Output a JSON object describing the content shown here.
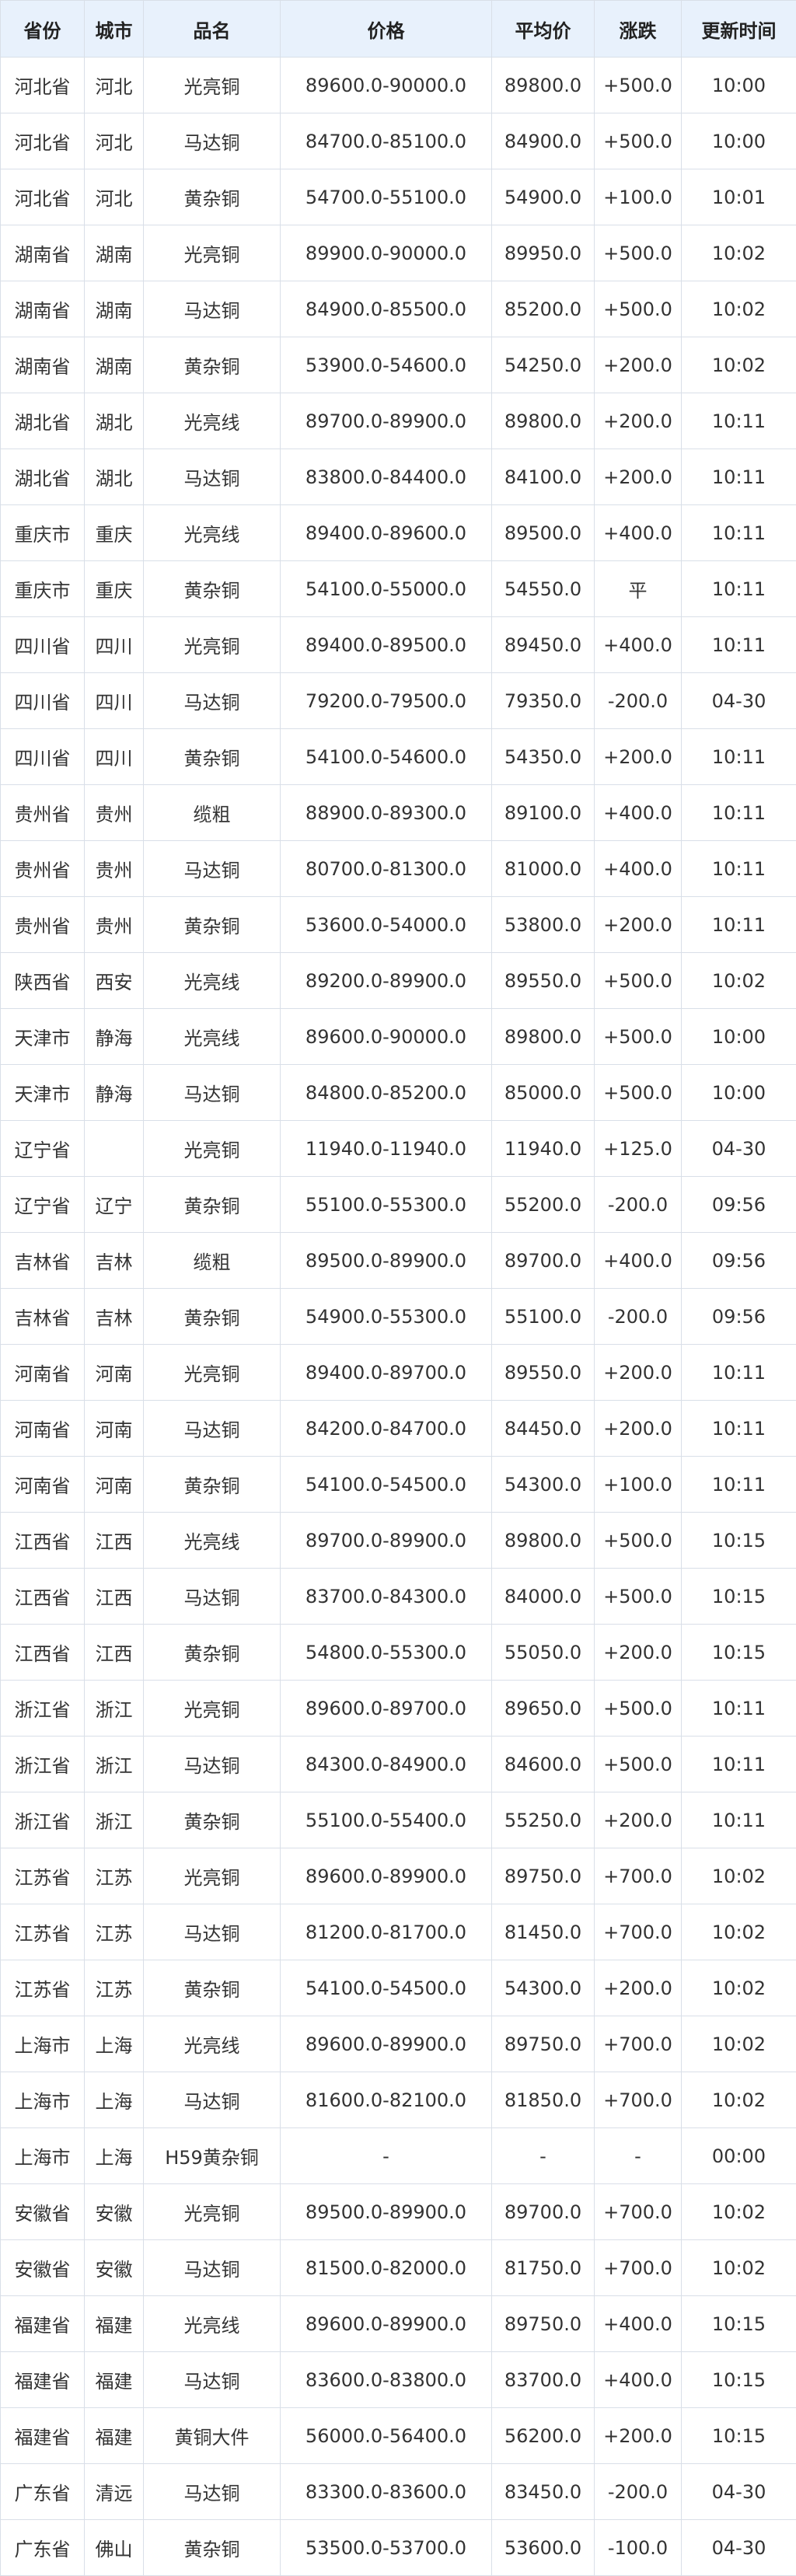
{
  "table": {
    "columns": [
      "省份",
      "城市",
      "品名",
      "价格",
      "平均价",
      "涨跌",
      "更新时间"
    ],
    "rows": [
      {
        "province": "河北省",
        "city": "河北",
        "product": "光亮铜",
        "price": "89600.0-90000.0",
        "avg": "89800.0",
        "change": "+500.0",
        "trend": "up",
        "time": "10:00"
      },
      {
        "province": "河北省",
        "city": "河北",
        "product": "马达铜",
        "price": "84700.0-85100.0",
        "avg": "84900.0",
        "change": "+500.0",
        "trend": "up",
        "time": "10:00"
      },
      {
        "province": "河北省",
        "city": "河北",
        "product": "黄杂铜",
        "price": "54700.0-55100.0",
        "avg": "54900.0",
        "change": "+100.0",
        "trend": "up",
        "time": "10:01"
      },
      {
        "province": "湖南省",
        "city": "湖南",
        "product": "光亮铜",
        "price": "89900.0-90000.0",
        "avg": "89950.0",
        "change": "+500.0",
        "trend": "up",
        "time": "10:02"
      },
      {
        "province": "湖南省",
        "city": "湖南",
        "product": "马达铜",
        "price": "84900.0-85500.0",
        "avg": "85200.0",
        "change": "+500.0",
        "trend": "up",
        "time": "10:02"
      },
      {
        "province": "湖南省",
        "city": "湖南",
        "product": "黄杂铜",
        "price": "53900.0-54600.0",
        "avg": "54250.0",
        "change": "+200.0",
        "trend": "up",
        "time": "10:02"
      },
      {
        "province": "湖北省",
        "city": "湖北",
        "product": "光亮线",
        "price": "89700.0-89900.0",
        "avg": "89800.0",
        "change": "+200.0",
        "trend": "up",
        "time": "10:11"
      },
      {
        "province": "湖北省",
        "city": "湖北",
        "product": "马达铜",
        "price": "83800.0-84400.0",
        "avg": "84100.0",
        "change": "+200.0",
        "trend": "up",
        "time": "10:11"
      },
      {
        "province": "重庆市",
        "city": "重庆",
        "product": "光亮线",
        "price": "89400.0-89600.0",
        "avg": "89500.0",
        "change": "+400.0",
        "trend": "up",
        "time": "10:11"
      },
      {
        "province": "重庆市",
        "city": "重庆",
        "product": "黄杂铜",
        "price": "54100.0-55000.0",
        "avg": "54550.0",
        "change": "平",
        "trend": "flat",
        "time": "10:11"
      },
      {
        "province": "四川省",
        "city": "四川",
        "product": "光亮铜",
        "price": "89400.0-89500.0",
        "avg": "89450.0",
        "change": "+400.0",
        "trend": "up",
        "time": "10:11"
      },
      {
        "province": "四川省",
        "city": "四川",
        "product": "马达铜",
        "price": "79200.0-79500.0",
        "avg": "79350.0",
        "change": "-200.0",
        "trend": "down",
        "time": "04-30"
      },
      {
        "province": "四川省",
        "city": "四川",
        "product": "黄杂铜",
        "price": "54100.0-54600.0",
        "avg": "54350.0",
        "change": "+200.0",
        "trend": "up",
        "time": "10:11"
      },
      {
        "province": "贵州省",
        "city": "贵州",
        "product": "缆粗",
        "price": "88900.0-89300.0",
        "avg": "89100.0",
        "change": "+400.0",
        "trend": "up",
        "time": "10:11"
      },
      {
        "province": "贵州省",
        "city": "贵州",
        "product": "马达铜",
        "price": "80700.0-81300.0",
        "avg": "81000.0",
        "change": "+400.0",
        "trend": "up",
        "time": "10:11"
      },
      {
        "province": "贵州省",
        "city": "贵州",
        "product": "黄杂铜",
        "price": "53600.0-54000.0",
        "avg": "53800.0",
        "change": "+200.0",
        "trend": "up",
        "time": "10:11"
      },
      {
        "province": "陕西省",
        "city": "西安",
        "product": "光亮线",
        "price": "89200.0-89900.0",
        "avg": "89550.0",
        "change": "+500.0",
        "trend": "up",
        "time": "10:02"
      },
      {
        "province": "天津市",
        "city": "静海",
        "product": "光亮线",
        "price": "89600.0-90000.0",
        "avg": "89800.0",
        "change": "+500.0",
        "trend": "up",
        "time": "10:00"
      },
      {
        "province": "天津市",
        "city": "静海",
        "product": "马达铜",
        "price": "84800.0-85200.0",
        "avg": "85000.0",
        "change": "+500.0",
        "trend": "up",
        "time": "10:00"
      },
      {
        "province": "辽宁省",
        "city": "",
        "product": "光亮铜",
        "price": "11940.0-11940.0",
        "avg": "11940.0",
        "change": "+125.0",
        "trend": "up",
        "time": "04-30"
      },
      {
        "province": "辽宁省",
        "city": "辽宁",
        "product": "黄杂铜",
        "price": "55100.0-55300.0",
        "avg": "55200.0",
        "change": "-200.0",
        "trend": "down",
        "time": "09:56"
      },
      {
        "province": "吉林省",
        "city": "吉林",
        "product": "缆粗",
        "price": "89500.0-89900.0",
        "avg": "89700.0",
        "change": "+400.0",
        "trend": "up",
        "time": "09:56"
      },
      {
        "province": "吉林省",
        "city": "吉林",
        "product": "黄杂铜",
        "price": "54900.0-55300.0",
        "avg": "55100.0",
        "change": "-200.0",
        "trend": "down",
        "time": "09:56"
      },
      {
        "province": "河南省",
        "city": "河南",
        "product": "光亮铜",
        "price": "89400.0-89700.0",
        "avg": "89550.0",
        "change": "+200.0",
        "trend": "up",
        "time": "10:11"
      },
      {
        "province": "河南省",
        "city": "河南",
        "product": "马达铜",
        "price": "84200.0-84700.0",
        "avg": "84450.0",
        "change": "+200.0",
        "trend": "up",
        "time": "10:11"
      },
      {
        "province": "河南省",
        "city": "河南",
        "product": "黄杂铜",
        "price": "54100.0-54500.0",
        "avg": "54300.0",
        "change": "+100.0",
        "trend": "up",
        "time": "10:11"
      },
      {
        "province": "江西省",
        "city": "江西",
        "product": "光亮线",
        "price": "89700.0-89900.0",
        "avg": "89800.0",
        "change": "+500.0",
        "trend": "up",
        "time": "10:15"
      },
      {
        "province": "江西省",
        "city": "江西",
        "product": "马达铜",
        "price": "83700.0-84300.0",
        "avg": "84000.0",
        "change": "+500.0",
        "trend": "up",
        "time": "10:15"
      },
      {
        "province": "江西省",
        "city": "江西",
        "product": "黄杂铜",
        "price": "54800.0-55300.0",
        "avg": "55050.0",
        "change": "+200.0",
        "trend": "up",
        "time": "10:15"
      },
      {
        "province": "浙江省",
        "city": "浙江",
        "product": "光亮铜",
        "price": "89600.0-89700.0",
        "avg": "89650.0",
        "change": "+500.0",
        "trend": "up",
        "time": "10:11"
      },
      {
        "province": "浙江省",
        "city": "浙江",
        "product": "马达铜",
        "price": "84300.0-84900.0",
        "avg": "84600.0",
        "change": "+500.0",
        "trend": "up",
        "time": "10:11"
      },
      {
        "province": "浙江省",
        "city": "浙江",
        "product": "黄杂铜",
        "price": "55100.0-55400.0",
        "avg": "55250.0",
        "change": "+200.0",
        "trend": "up",
        "time": "10:11"
      },
      {
        "province": "江苏省",
        "city": "江苏",
        "product": "光亮铜",
        "price": "89600.0-89900.0",
        "avg": "89750.0",
        "change": "+700.0",
        "trend": "up",
        "time": "10:02"
      },
      {
        "province": "江苏省",
        "city": "江苏",
        "product": "马达铜",
        "price": "81200.0-81700.0",
        "avg": "81450.0",
        "change": "+700.0",
        "trend": "up",
        "time": "10:02"
      },
      {
        "province": "江苏省",
        "city": "江苏",
        "product": "黄杂铜",
        "price": "54100.0-54500.0",
        "avg": "54300.0",
        "change": "+200.0",
        "trend": "up",
        "time": "10:02"
      },
      {
        "province": "上海市",
        "city": "上海",
        "product": "光亮线",
        "price": "89600.0-89900.0",
        "avg": "89750.0",
        "change": "+700.0",
        "trend": "up",
        "time": "10:02"
      },
      {
        "province": "上海市",
        "city": "上海",
        "product": "马达铜",
        "price": "81600.0-82100.0",
        "avg": "81850.0",
        "change": "+700.0",
        "trend": "up",
        "time": "10:02"
      },
      {
        "province": "上海市",
        "city": "上海",
        "product": "H59黄杂铜",
        "price": "-",
        "avg": "-",
        "change": "-",
        "trend": "none",
        "time": "00:00"
      },
      {
        "province": "安徽省",
        "city": "安徽",
        "product": "光亮铜",
        "price": "89500.0-89900.0",
        "avg": "89700.0",
        "change": "+700.0",
        "trend": "up",
        "time": "10:02"
      },
      {
        "province": "安徽省",
        "city": "安徽",
        "product": "马达铜",
        "price": "81500.0-82000.0",
        "avg": "81750.0",
        "change": "+700.0",
        "trend": "up",
        "time": "10:02"
      },
      {
        "province": "福建省",
        "city": "福建",
        "product": "光亮线",
        "price": "89600.0-89900.0",
        "avg": "89750.0",
        "change": "+400.0",
        "trend": "up",
        "time": "10:15"
      },
      {
        "province": "福建省",
        "city": "福建",
        "product": "马达铜",
        "price": "83600.0-83800.0",
        "avg": "83700.0",
        "change": "+400.0",
        "trend": "up",
        "time": "10:15"
      },
      {
        "province": "福建省",
        "city": "福建",
        "product": "黄铜大件",
        "price": "56000.0-56400.0",
        "avg": "56200.0",
        "change": "+200.0",
        "trend": "up",
        "time": "10:15"
      },
      {
        "province": "广东省",
        "city": "清远",
        "product": "马达铜",
        "price": "83300.0-83600.0",
        "avg": "83450.0",
        "change": "-200.0",
        "trend": "down",
        "time": "04-30"
      },
      {
        "province": "广东省",
        "city": "佛山",
        "product": "黄杂铜",
        "price": "53500.0-53700.0",
        "avg": "53600.0",
        "change": "-100.0",
        "trend": "down",
        "time": "04-30"
      }
    ]
  },
  "colors": {
    "header_bg": "#e8f1fc",
    "border": "#d9dfe8",
    "up": "#e02020",
    "down": "#1a8a1a",
    "text": "#333333"
  }
}
